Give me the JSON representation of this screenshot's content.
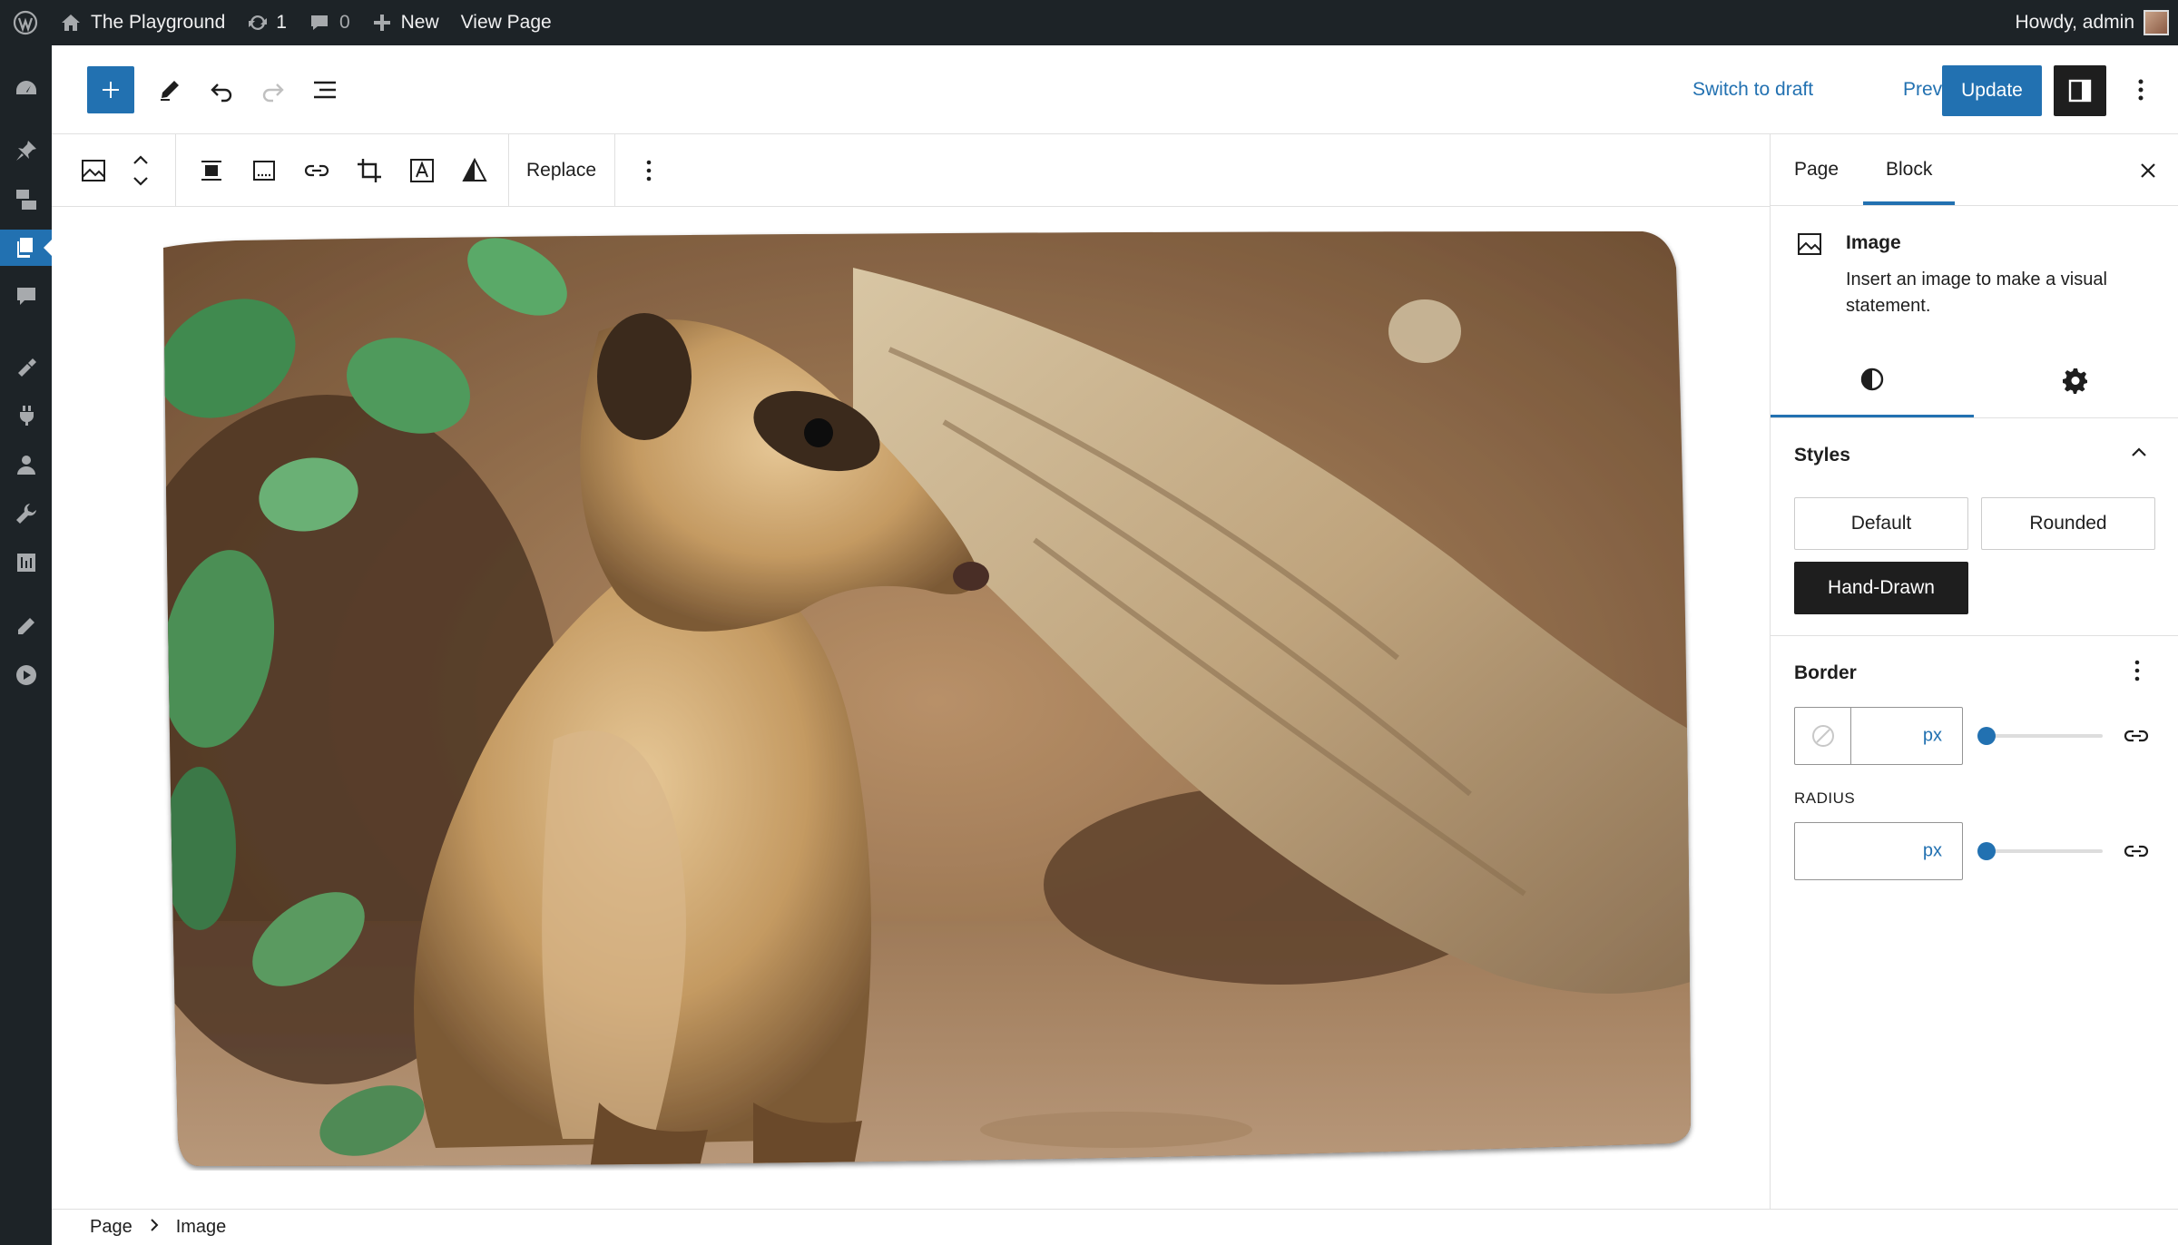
{
  "adminbar": {
    "site_name": "The Playground",
    "updates_count": "1",
    "comments_count": "0",
    "new_label": "New",
    "view_page_label": "View Page",
    "howdy_label": "Howdy, admin"
  },
  "header": {
    "switch_to_draft": "Switch to draft",
    "preview": "Preview",
    "update": "Update"
  },
  "block_toolbar": {
    "replace_label": "Replace"
  },
  "breadcrumb": {
    "items": [
      "Page",
      "Image"
    ]
  },
  "sidebar": {
    "tabs": [
      "Page",
      "Block"
    ],
    "active_tab": "Block",
    "block_card": {
      "title": "Image",
      "description": "Insert an image to make a visual statement."
    },
    "styles_panel": {
      "title": "Styles",
      "options": [
        "Default",
        "Rounded",
        "Hand-Drawn"
      ],
      "selected": "Hand-Drawn"
    },
    "border_panel": {
      "title": "Border",
      "width_unit": "px",
      "radius_label": "RADIUS",
      "radius_unit": "px",
      "width_slider_value": 0,
      "radius_slider_value": 0
    }
  },
  "colors": {
    "admin_dark": "#1d2327",
    "accent_blue": "#2271b1"
  }
}
